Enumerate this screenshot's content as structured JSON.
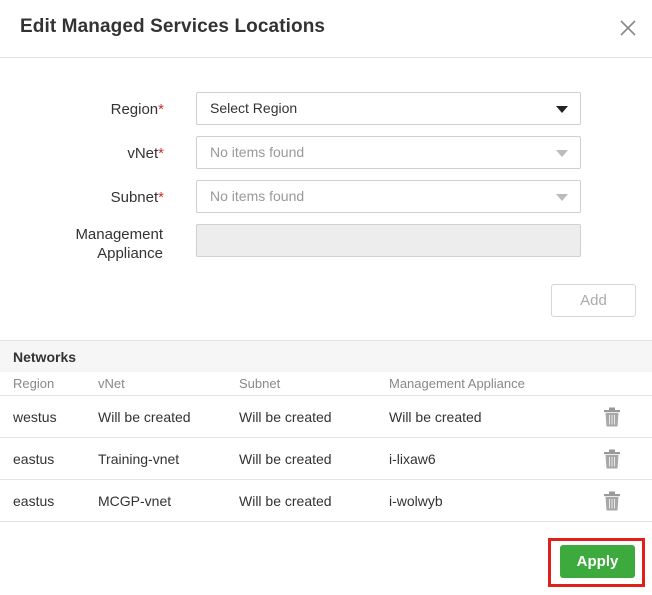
{
  "dialog": {
    "title": "Edit Managed Services Locations"
  },
  "form": {
    "region": {
      "label": "Region",
      "required_mark": "*",
      "value": "Select Region"
    },
    "vnet": {
      "label": "vNet",
      "required_mark": "*",
      "value": "No items found"
    },
    "subnet": {
      "label": "Subnet",
      "required_mark": "*",
      "value": "No items found"
    },
    "appliance": {
      "label_line1": "Management",
      "label_line2": "Appliance",
      "value": ""
    },
    "add_label": "Add"
  },
  "networks": {
    "heading": "Networks",
    "columns": [
      "Region",
      "vNet",
      "Subnet",
      "Management Appliance"
    ],
    "rows": [
      [
        "westus",
        "Will be created",
        "Will be created",
        "Will be created"
      ],
      [
        "eastus",
        "Training-vnet",
        "Will be created",
        "i-lixaw6"
      ],
      [
        "eastus",
        "MCGP-vnet",
        "Will be created",
        "i-wolwyb"
      ]
    ]
  },
  "footer": {
    "apply_label": "Apply"
  },
  "colors": {
    "accent_green": "#3daa3d",
    "highlight_red": "#e0201b",
    "required_red": "#c0392b"
  },
  "icons": [
    "close-icon",
    "chevron-down-icon",
    "trash-icon"
  ]
}
